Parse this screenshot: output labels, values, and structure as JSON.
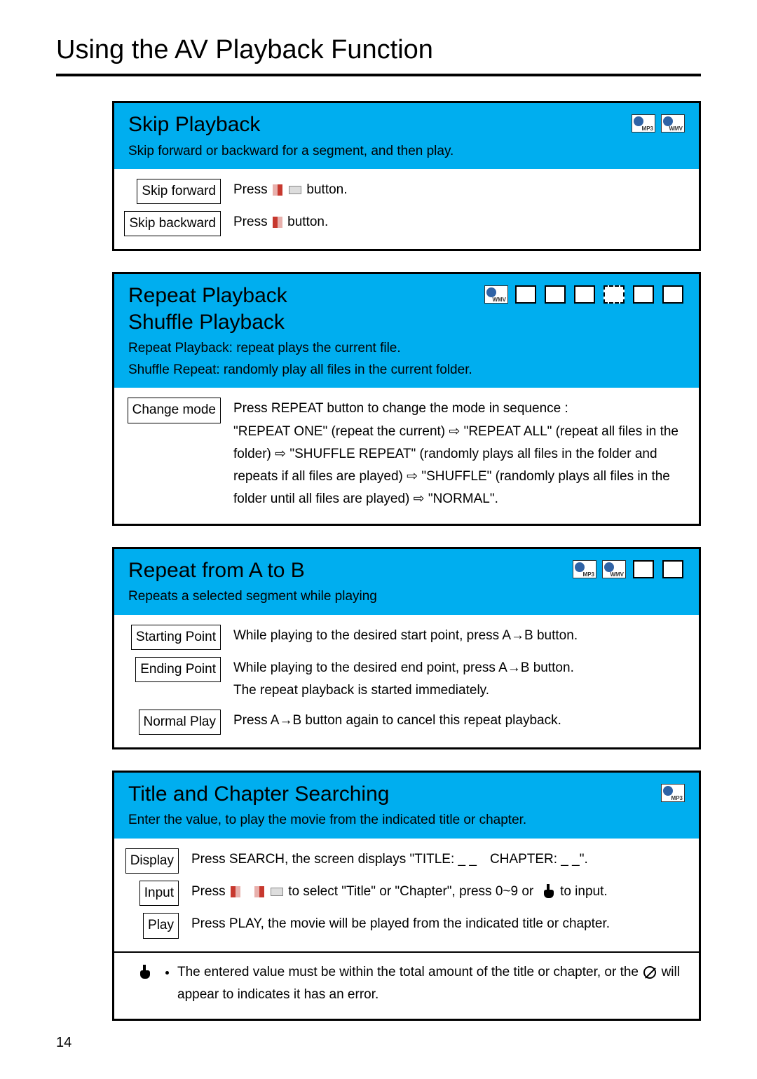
{
  "page_title": "Using the AV Playback Function",
  "page_number": "14",
  "skip": {
    "title": "Skip Playback",
    "icons": [
      "mp3-icon",
      "wmv-icon"
    ],
    "sub": "Skip forward or backward for a segment, and then play.",
    "rows": [
      {
        "label": "Skip forward",
        "text_a": "Press ",
        "text_b": " button."
      },
      {
        "label": "Skip backward",
        "text_a": "Press ",
        "text_b": " button."
      }
    ]
  },
  "repeat": {
    "title_line1": "Repeat Playback",
    "title_line2": "Shuffle Playback",
    "icons": [
      "wmv-icon",
      "box",
      "box",
      "box",
      "dashed-box",
      "box",
      "box"
    ],
    "sub_line1": "Repeat Playback: repeat plays the current file.",
    "sub_line2": "Shuffle Repeat: randomly play all files in the current folder.",
    "row_label": "Change mode",
    "row_text": "Press REPEAT button to change the mode in sequence :\n\"REPEAT ONE\" (repeat the current) ⇨ \"REPEAT ALL\" (repeat all files in the folder) ⇨ \"SHUFFLE REPEAT\" (randomly plays all files in the folder and repeats if all files are played) ⇨ \"SHUFFLE\" (randomly plays all files in the folder until all files are played) ⇨ \"NORMAL\"."
  },
  "ab": {
    "title": "Repeat from A to B",
    "icons": [
      "mp3-icon",
      "wmv-icon",
      "box",
      "box"
    ],
    "sub": "Repeats a selected segment while playing",
    "rows": [
      {
        "label": "Starting Point",
        "text": "While playing to the desired start point, press A→B button."
      },
      {
        "label": "Ending Point",
        "text": "While playing to the desired end point, press A→B button.\nThe repeat playback is started immediately."
      },
      {
        "label": "Normal Play",
        "text": "Press A→B button again to cancel this repeat playback."
      }
    ]
  },
  "search": {
    "title": "Title and Chapter Searching",
    "icons": [
      "mp3-icon"
    ],
    "sub": "Enter the value, to play the movie from the indicated title or chapter.",
    "rows": [
      {
        "label": "Display",
        "text": "Press SEARCH, the screen displays \"TITLE: _ _ CHAPTER: _ _\"."
      },
      {
        "label": "Input",
        "text_a": "Press ",
        "text_mid": " to select \"Title\" or \"Chapter\", press 0~9 or ",
        "text_b": " to input."
      },
      {
        "label": "Play",
        "text": "Press PLAY, the movie will be played from the indicated title or chapter."
      }
    ],
    "note": {
      "text_a": "The entered value must be within the total amount of the title or chapter, or the ",
      "text_b": " will appear to indicates it has an error."
    }
  }
}
